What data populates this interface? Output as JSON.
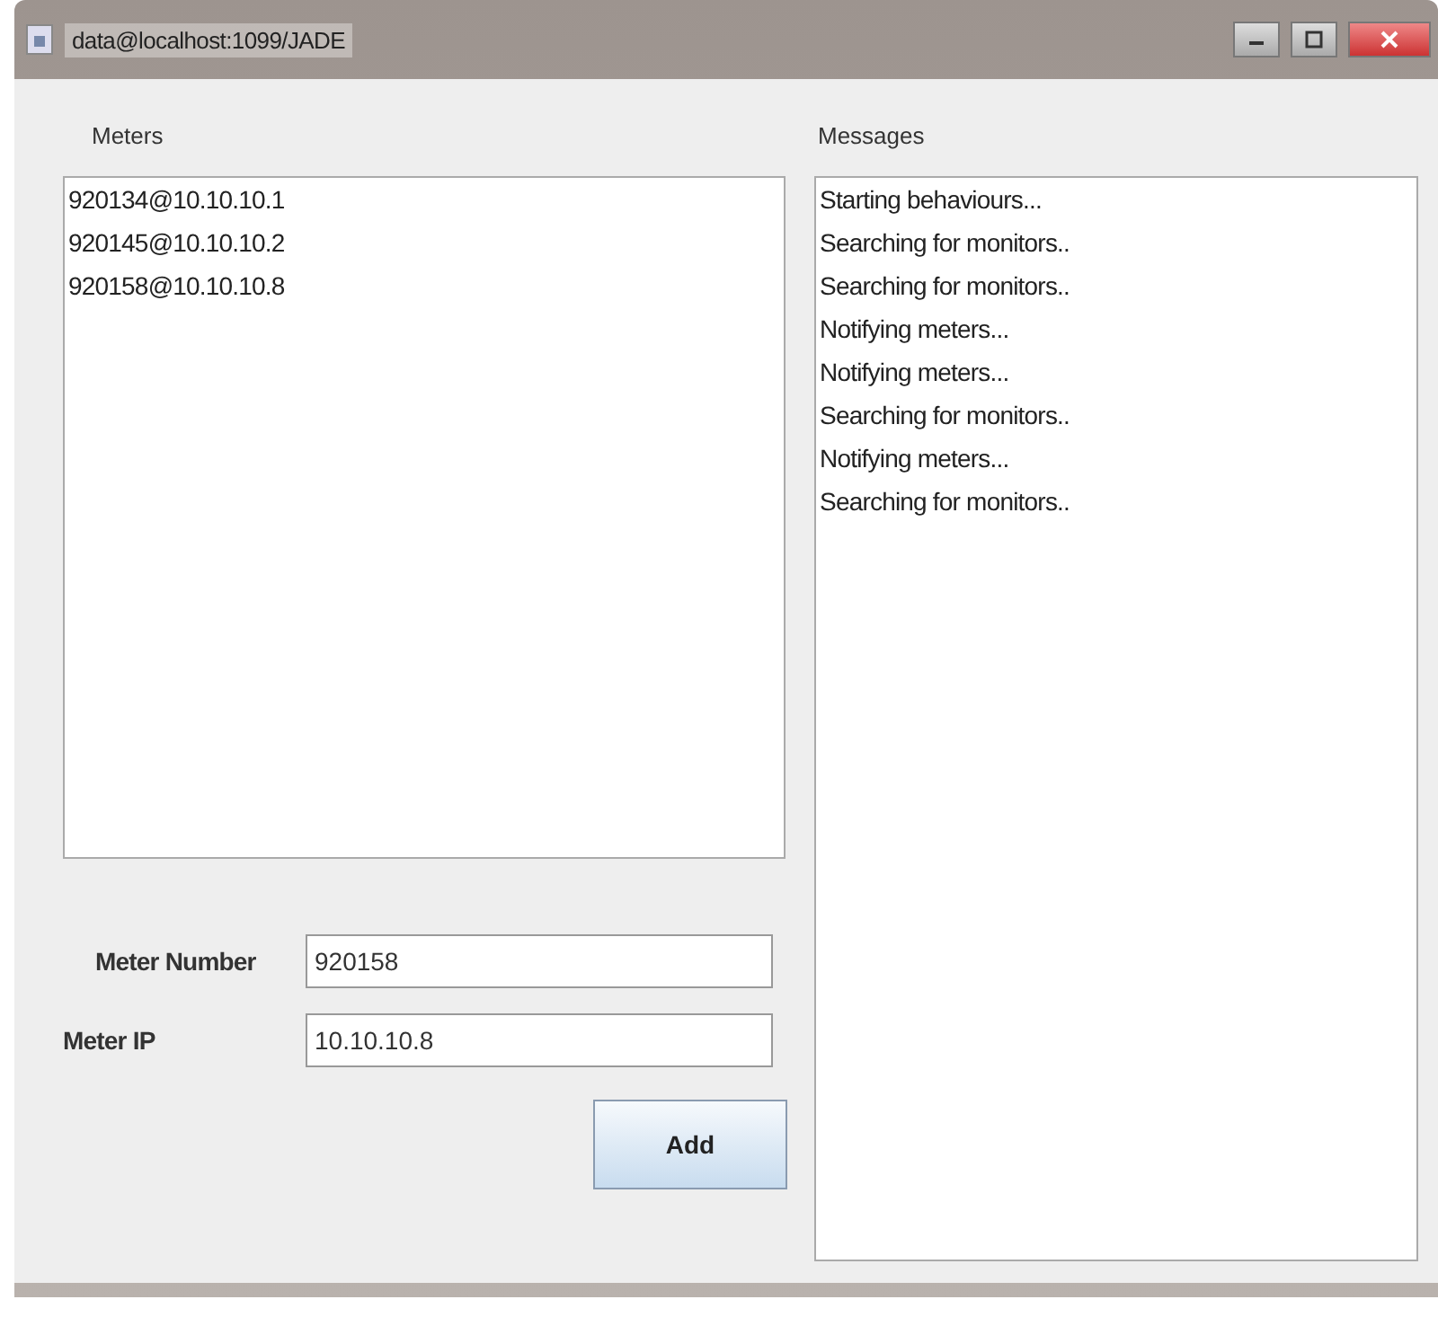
{
  "window": {
    "title": "data@localhost:1099/JADE"
  },
  "meters": {
    "label": "Meters",
    "items": [
      "920134@10.10.10.1",
      "920145@10.10.10.2",
      "920158@10.10.10.8"
    ]
  },
  "messages": {
    "label": "Messages",
    "items": [
      "Starting behaviours...",
      "Searching for monitors..",
      "Searching for monitors..",
      "Notifying meters...",
      "Notifying meters...",
      "Searching for monitors..",
      "Notifying meters...",
      "Searching for monitors.."
    ]
  },
  "form": {
    "fields": [
      {
        "label": "Meter Number",
        "value": "920158"
      },
      {
        "label": "Meter IP",
        "value": "10.10.10.8"
      }
    ],
    "button": "Add"
  }
}
